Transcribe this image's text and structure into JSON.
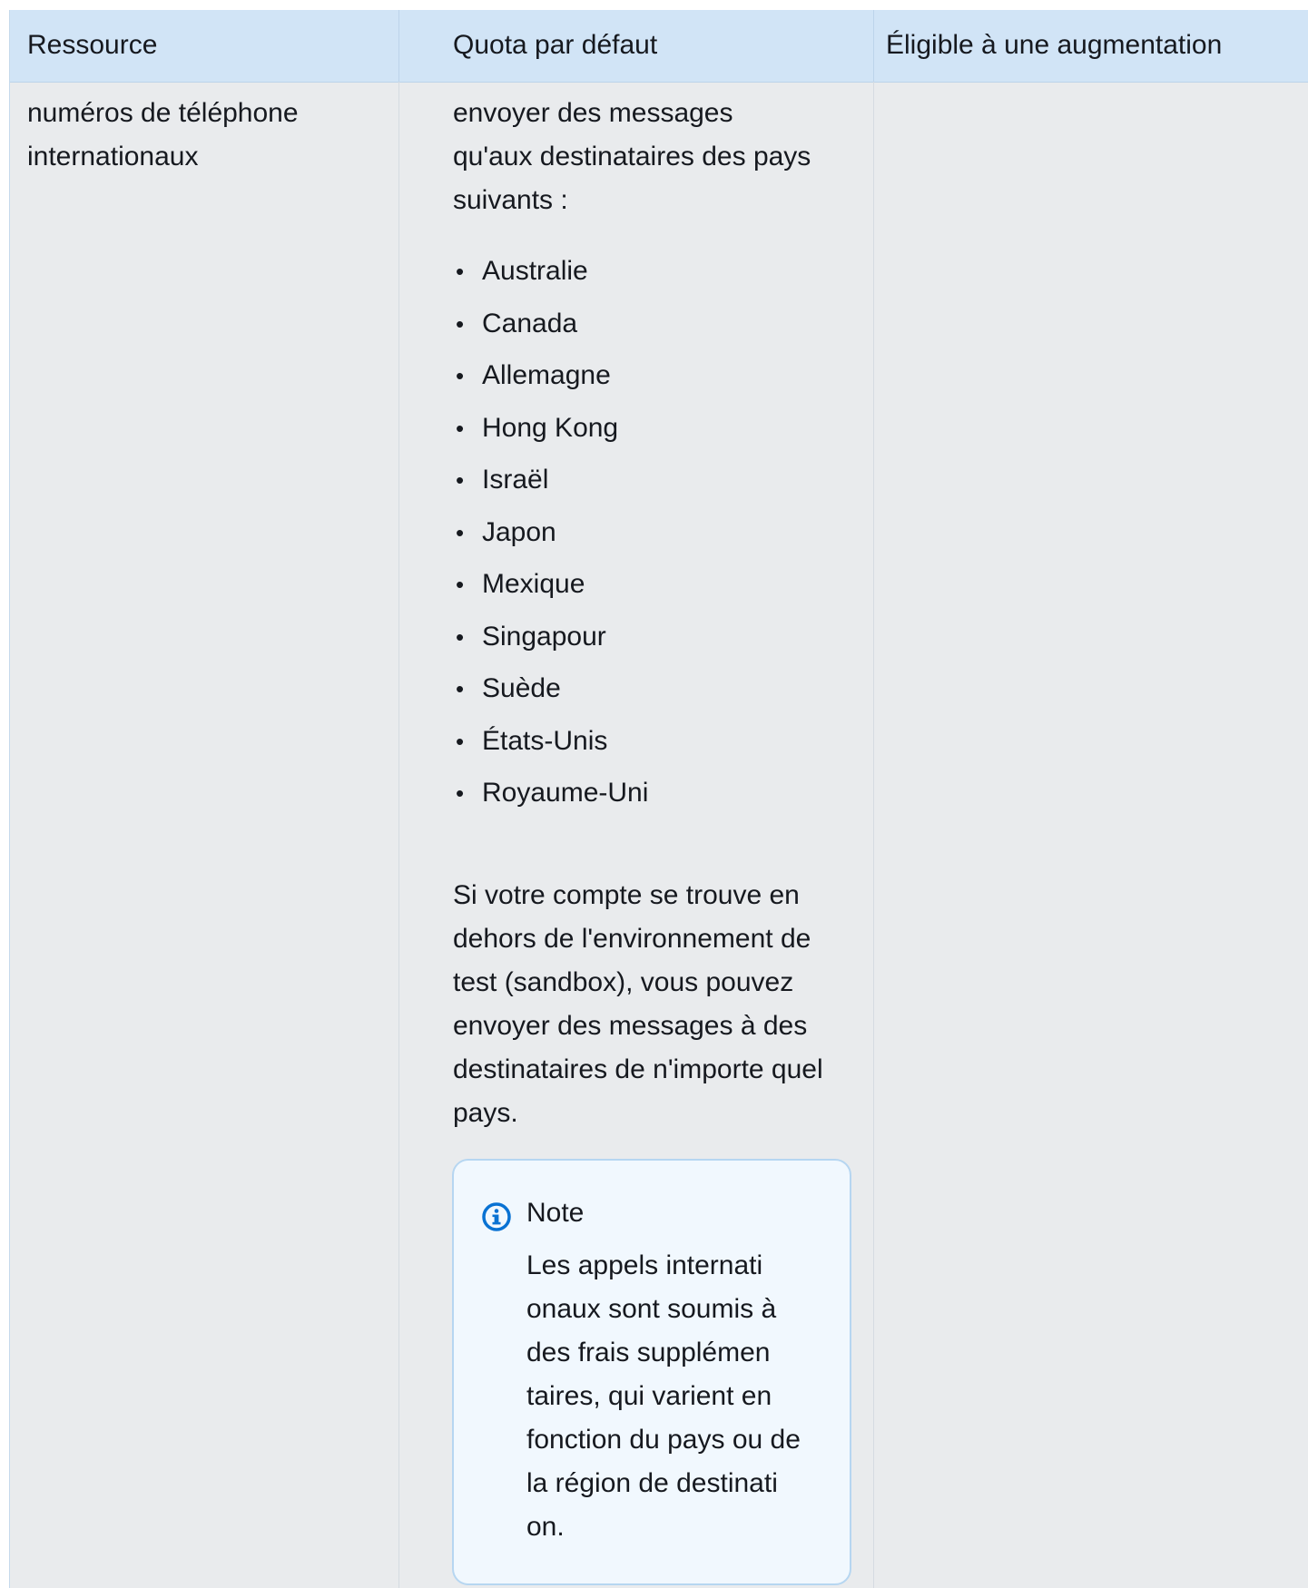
{
  "table": {
    "headers": {
      "resource": "Ressource",
      "default_quota": "Quota par défaut",
      "eligible": "Éligible à une augmentation"
    },
    "row": {
      "resource_lines": [
        "numéros de téléphone",
        "internationaux"
      ],
      "quota_intro_lines": [
        "envoyer des messages",
        "qu'aux destinataires des pays",
        "suivants :"
      ],
      "countries": [
        "Australie",
        "Canada",
        "Allemagne",
        "Hong Kong",
        "Israël",
        "Japon",
        "Mexique",
        "Singapour",
        "Suède",
        "États-Unis",
        "Royaume-Uni"
      ],
      "quota_outro_lines": [
        "Si votre compte se trouve en",
        "dehors de l'environnement de",
        "test (sandbox), vous pouvez",
        "envoyer des messages à des",
        "destinataires de n'importe quel",
        "pays."
      ],
      "note": {
        "icon": "info-circle-icon",
        "title": "Note",
        "body_lines": [
          "Les appels internati",
          "onaux sont soumis à",
          "des frais supplémen",
          "taires, qui varient en",
          "fonction du pays ou de",
          "la région de destinati",
          "on."
        ]
      },
      "eligible": ""
    }
  },
  "colors": {
    "header_bg": "#d1e4f6",
    "row_bg": "#e9ebed",
    "note_bg": "#f1f8fe",
    "note_border": "#b6d6f1",
    "info_icon": "#0972d3"
  }
}
